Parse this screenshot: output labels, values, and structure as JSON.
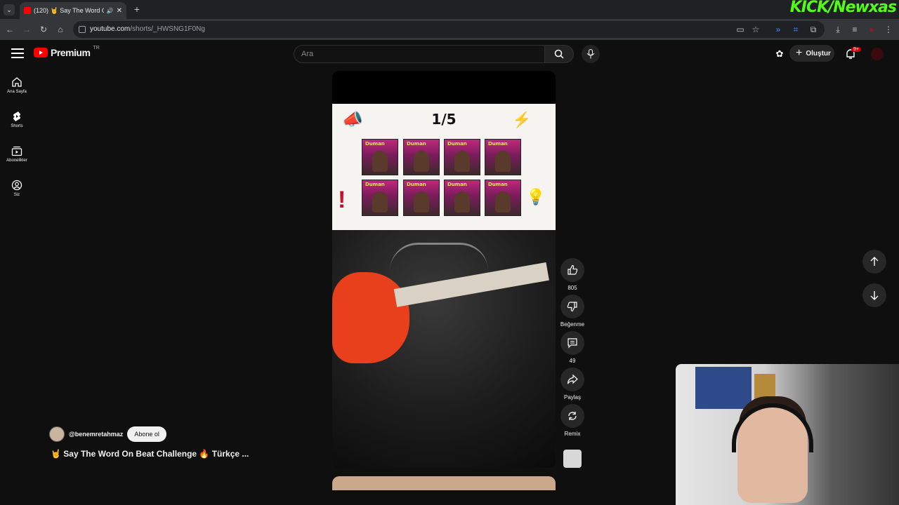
{
  "browser": {
    "tab_title": "(120) 🤘 Say The Word On |",
    "url_host": "youtube.com",
    "url_path": "/shorts/_HWSNG1F0Ng",
    "overlay_logo": "KICK/Newxas"
  },
  "header": {
    "logo_text": "Premium",
    "region": "TR",
    "search_placeholder": "Ara",
    "create_label": "Oluştur",
    "notif_badge": "9+"
  },
  "sidebar": {
    "items": [
      {
        "label": "Ana Sayfa",
        "icon": "home-icon"
      },
      {
        "label": "Shorts",
        "icon": "shorts-icon"
      },
      {
        "label": "Abonelikler",
        "icon": "subscriptions-icon"
      },
      {
        "label": "Siz",
        "icon": "you-icon"
      }
    ]
  },
  "short": {
    "overlay_counter": "1/5",
    "overlay_word": "Duman",
    "channel": "@benemretahmaz",
    "subscribe_label": "Abone ol",
    "title": "🤘 Say The Word On Beat Challenge 🔥 Türkçe ..."
  },
  "actions": {
    "like_count": "805",
    "dislike_label": "Beğenme",
    "comment_count": "49",
    "share_label": "Paylaş",
    "remix_label": "Remix"
  },
  "colors": {
    "background": "#0f0f0f",
    "brand_red": "#ff0000",
    "button_bg": "#272727"
  }
}
